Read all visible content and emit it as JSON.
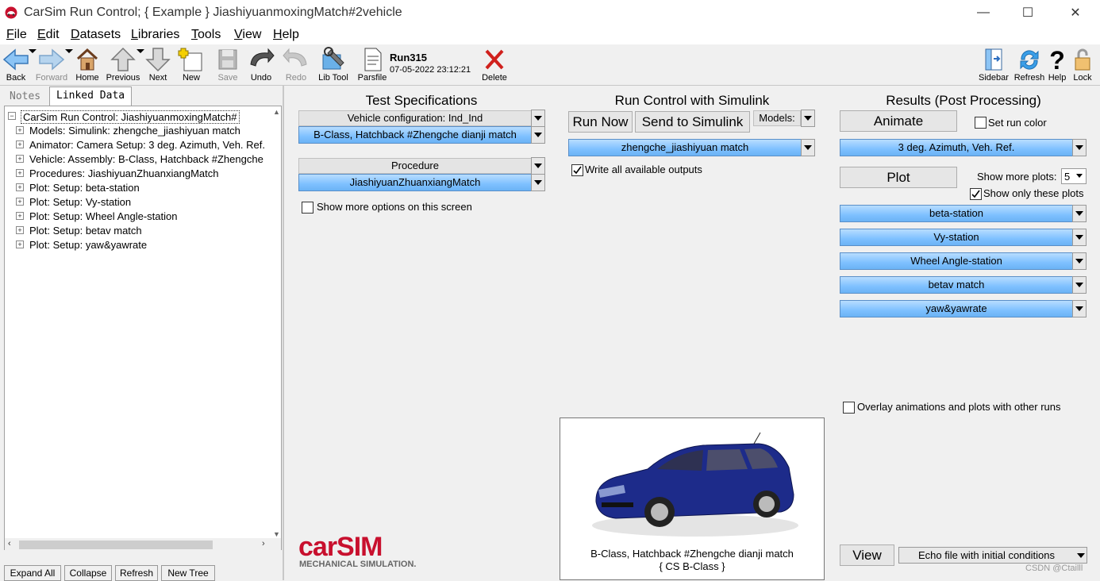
{
  "window": {
    "title": "CarSim Run Control;  { Example }  JiashiyuanmoxingMatch#2vehicle",
    "minimize": "—",
    "maximize": "☐",
    "close": "✕"
  },
  "menu": [
    "File",
    "Edit",
    "Datasets",
    "Libraries",
    "Tools",
    "View",
    "Help"
  ],
  "toolbar": {
    "back": "Back",
    "forward": "Forward",
    "home": "Home",
    "previous": "Previous",
    "next": "Next",
    "new": "New",
    "save": "Save",
    "undo": "Undo",
    "redo": "Redo",
    "libtool": "Lib Tool",
    "parsfile": "Parsfile",
    "run_name": "Run315",
    "run_date": "07-05-2022 23:12:21",
    "delete": "Delete",
    "sidebar": "Sidebar",
    "refresh": "Refresh",
    "help": "Help",
    "lock": "Lock"
  },
  "left": {
    "tabs": [
      "Notes",
      "Linked Data"
    ],
    "tree_root": "CarSim Run Control: JiashiyuanmoxingMatch#",
    "tree_items": [
      "Models: Simulink: zhengche_jiashiyuan match",
      "Animator: Camera Setup: 3 deg. Azimuth, Veh. Ref.",
      "Vehicle: Assembly: B-Class, Hatchback #Zhengche",
      "Procedures: JiashiyuanZhuanxiangMatch",
      "Plot: Setup: beta-station",
      "Plot: Setup: Vy-station",
      "Plot: Setup: Wheel Angle-station",
      "Plot: Setup: betav match",
      "Plot: Setup: yaw&yawrate"
    ],
    "buttons": [
      "Expand All",
      "Collapse",
      "Refresh",
      "New Tree"
    ]
  },
  "test_spec": {
    "title": "Test Specifications",
    "vehicle_config": "Vehicle configuration: Ind_Ind",
    "vehicle": "B-Class, Hatchback #Zhengche dianji match",
    "procedure_header": "Procedure",
    "procedure": "JiashiyuanZhuanxiangMatch",
    "show_more": "Show more options on this screen"
  },
  "run_control": {
    "title": "Run Control with Simulink",
    "run_now": "Run Now",
    "send": "Send to Simulink",
    "models": "Models:",
    "model": "zhengche_jiashiyuan match",
    "write_outputs": "Write all available outputs"
  },
  "results": {
    "title": "Results (Post Processing)",
    "animate": "Animate",
    "set_run_color": "Set run color",
    "animator": "3 deg. Azimuth, Veh. Ref.",
    "plot": "Plot",
    "show_more_plots": "Show more plots:",
    "plot_count": "5",
    "show_only": "Show only these plots",
    "plots": [
      "beta-station",
      "Vy-station",
      "Wheel Angle-station",
      "betav match",
      "yaw&yawrate"
    ],
    "overlay": "Overlay animations and plots with other runs",
    "view": "View",
    "echo": "Echo file with initial conditions"
  },
  "vehicle_image": {
    "caption1": "B-Class, Hatchback #Zhengche dianji match",
    "caption2": "{ CS B-Class }"
  },
  "logo": {
    "brand": "carSIM",
    "tagline": "MECHANICAL SIMULATION."
  },
  "watermark": "CSDN @Ctailll",
  "colors": {
    "accent_blue": "#7ec0ff",
    "delete_red": "#d0201c",
    "logo_red": "#c8102e"
  }
}
